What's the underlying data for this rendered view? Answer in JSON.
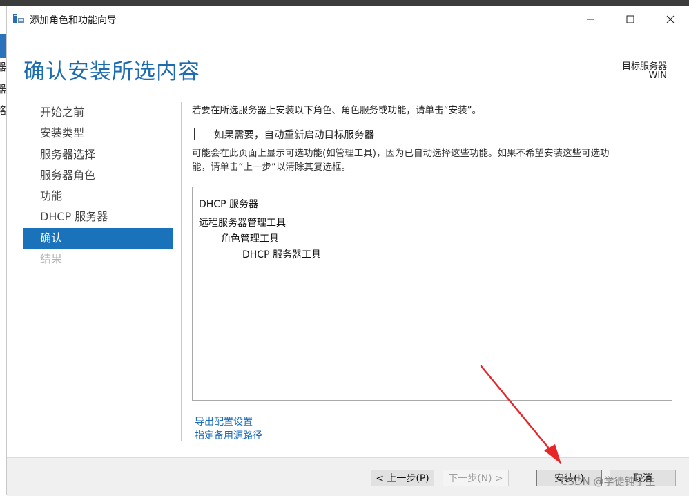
{
  "window": {
    "title": "添加角色和功能向导",
    "icons": {
      "app": "server-manager-icon",
      "minimize": "minimize-icon",
      "maximize": "maximize-icon",
      "close": "close-icon"
    }
  },
  "background": {
    "left_edge_chars": [
      "器",
      "器",
      "略"
    ]
  },
  "page": {
    "heading": "确认安装所选内容",
    "destination_label": "目标服务器",
    "destination_value": "WIN"
  },
  "nav": {
    "items": [
      {
        "label": "开始之前",
        "state": "normal"
      },
      {
        "label": "安装类型",
        "state": "normal"
      },
      {
        "label": "服务器选择",
        "state": "normal"
      },
      {
        "label": "服务器角色",
        "state": "normal"
      },
      {
        "label": "功能",
        "state": "normal"
      },
      {
        "label": "DHCP 服务器",
        "state": "normal"
      },
      {
        "label": "确认",
        "state": "active"
      },
      {
        "label": "结果",
        "state": "disabled"
      }
    ]
  },
  "content": {
    "intro": "若要在所选服务器上安装以下角色、角色服务或功能，请单击“安装”。",
    "restart_checkbox": {
      "label": "如果需要，自动重新启动目标服务器",
      "checked": false
    },
    "note_line1": "可能会在此页面上显示可选功能(如管理工具)，因为已自动选择这些功能。如果不希望安装这些可选功",
    "note_line2": "能，请单击“上一步”以清除其复选框。",
    "selection_list": [
      {
        "text": "DHCP 服务器",
        "level": 0
      },
      {
        "text": "远程服务器管理工具",
        "level": 0
      },
      {
        "text": "角色管理工具",
        "level": 1
      },
      {
        "text": "DHCP 服务器工具",
        "level": 2
      }
    ],
    "links": {
      "export": "导出配置设置",
      "alternate_source": "指定备用源路径"
    }
  },
  "footer": {
    "back_label": "< 上一步(P)",
    "next_label": "下一步(N) >",
    "install_label": "安装(I)",
    "cancel_label": "取消"
  },
  "watermark": "CSDN @学徒钝子生",
  "annotation": {
    "color": "#e8262a",
    "icon": "red-arrow-annotation"
  }
}
